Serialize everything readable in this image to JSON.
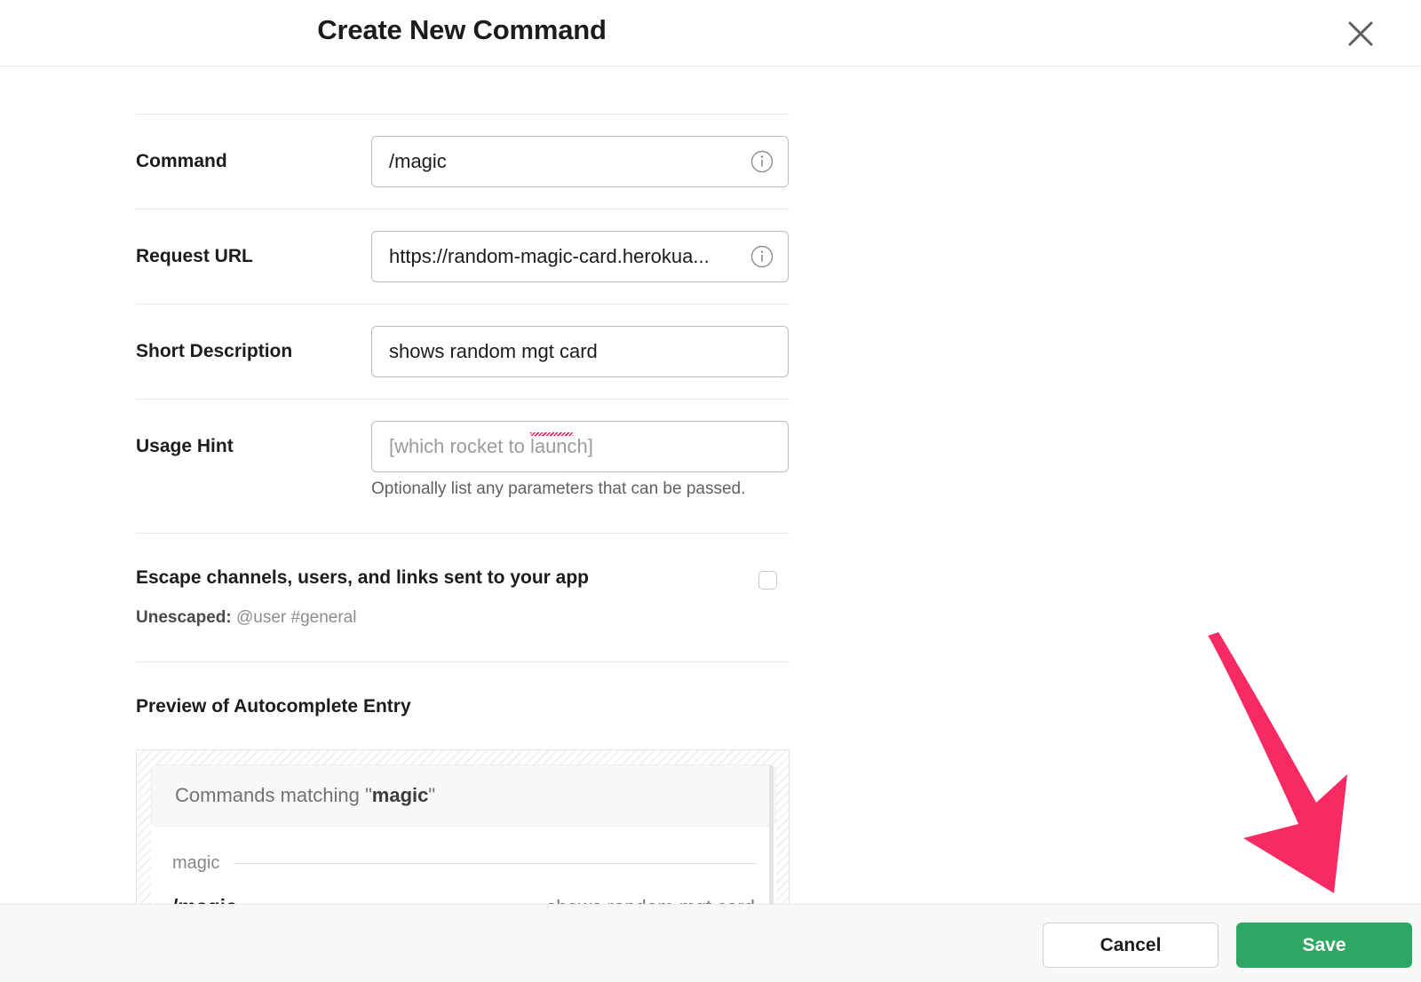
{
  "header": {
    "title": "Create New Command",
    "close_icon": "close-icon"
  },
  "form": {
    "command": {
      "label": "Command",
      "value": "/magic",
      "placeholder": "",
      "info_icon": "info-icon"
    },
    "request_url": {
      "label": "Request URL",
      "value": "https://random-magic-card.herokua...",
      "placeholder": "",
      "info_icon": "info-icon"
    },
    "short_description": {
      "label": "Short Description",
      "value": "shows random mgt card",
      "placeholder": ""
    },
    "usage_hint": {
      "label": "Usage Hint",
      "value": "",
      "placeholder": "[which rocket to launch]",
      "helper": "Optionally list any parameters that can be passed."
    },
    "escape": {
      "title": "Escape channels, users, and links sent to your app",
      "sub_label": "Unescaped:",
      "sub_value": "@user #general",
      "checked": false
    }
  },
  "preview": {
    "heading": "Preview of Autocomplete Entry",
    "matching_prefix": "Commands matching \"",
    "matching_term": "magic",
    "matching_suffix": "\"",
    "group_label": "magic",
    "items": [
      {
        "command": "/magic",
        "description": "shows random mgt card"
      }
    ]
  },
  "footer": {
    "cancel_label": "Cancel",
    "save_label": "Save"
  },
  "colors": {
    "accent_green": "#2ea664",
    "annotation_pink": "#f72a63",
    "text_primary": "#1d1c1d",
    "text_muted": "#767676",
    "border": "#e8e8e8",
    "footer_bg": "#f8f8f8"
  },
  "annotation": {
    "arrow_icon": "arrow-down-right-icon",
    "color": "#f72a63"
  }
}
